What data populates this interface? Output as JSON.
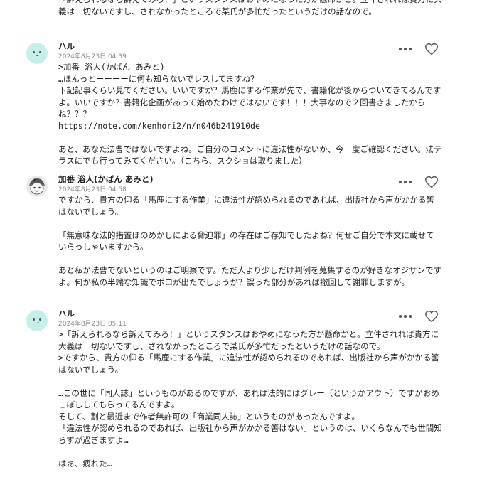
{
  "fragment": {
    "text": "「訴えられるなら訴えてみろ！」というスタンスはおやめになった方が懸命かと。立件されれば貴方に大義は一切ないですし、されなかったところで某氏が多忙だったというだけの話なので。"
  },
  "comments": [
    {
      "author": "ハル",
      "date": "2024年8月23日 04:39",
      "body": ">加番 浴人(かばん あみと)\n…ほんっとーーーーに何も知らないでレスしてますね？\n下記記事くらい見てください。いいですか？馬鹿にする作業が先で、書籍化が後からついてきてるんですよ。いいですか？書籍化企画があって始めたわけではないです！！！大事なので２回書きましたからね？？？\nhttps://note.com/kenhori2/n/n046b241910de\n\nあと、あなた法曹ではないですよね。ご自分のコメントに違法性がないか、今一度ご確認ください。法テラスにでも行ってみてください。（こちら、スクショは取りました）"
    },
    {
      "author": "加番 浴人(かばん あみと)",
      "date": "2024年8月23日 04:58",
      "body": "ですから、貴方の仰る「馬鹿にする作業」に違法性が認められるのであれば、出版社から声がかかる筈はないでしょう。\n\n「無意味な法的措置ほのめかしによる脅迫罪」の存在はご存知でしたよね？何せご自分で本文に載せていらっしゃいますから。\n\nあと私が法曹でないというのはご明察です。ただ人より少しだけ判例を蒐集するのが好きなオジサンですよ。何か私の半端な知識でボロが出たでしょうか？誤った部分があれば撤回して謝罪しますが。"
    },
    {
      "author": "ハル",
      "date": "2024年8月23日 05:11",
      "body": ">「訴えられるなら訴えてみろ！」というスタンスはおやめになった方が懸命かと。立件されれば貴方に大義は一切ないですし、されなかったところで某氏が多忙だったというだけの話なので。\n>ですから、貴方の仰る「馬鹿にする作業」に違法性が認められるのであれば、出版社から声がかかる筈はないでしょう。\n\n…この世に「同人誌」というものがあるのですが、あれは法的にはグレー（というかアウト）ですがおめこぼししてもらってるんですよ。\nそして、割と最近まで作者無許可の「商業同人誌」というものがあったんですよ。\n「違法性が認められるのであれば、出版社から声がかかる筈はない」というのは、いくらなんでも世間知らずが過ぎますよ…\n\nはぁ、疲れた…"
    }
  ],
  "icons": {
    "more": "more-horizontal-icon",
    "like": "heart-outline-icon",
    "avatar_haru": "mint-smiley-avatar",
    "avatar_kaban": "monochrome-character-avatar"
  },
  "colors": {
    "text": "#222222",
    "date": "#8a8a8a",
    "avatar_mint": "#c6efe9",
    "icon": "#555555"
  }
}
